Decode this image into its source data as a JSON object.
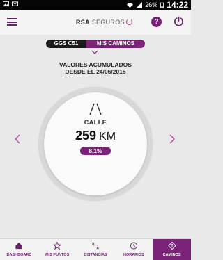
{
  "status_bar": {
    "battery_pct": "26%",
    "time": "14:22"
  },
  "header": {
    "logo_brand": "RSA",
    "logo_text": "SEGUROS",
    "help_label": "?"
  },
  "selector": {
    "left_tab": "GGS C51",
    "right_tab": "MIS CAMINOS"
  },
  "caption": {
    "line1": "VALORES ACUMULADOS",
    "line2": "DESDE EL 24/06/2015"
  },
  "gauge": {
    "category": "CALLE",
    "value": "259",
    "unit": "KM",
    "percent": "8,1%"
  },
  "nav": {
    "items": [
      {
        "label": "DASHBOARD",
        "icon": "home-icon"
      },
      {
        "label": "MIS PUNTOS",
        "icon": "star-icon"
      },
      {
        "label": "DISTANCIAS",
        "icon": "route-icon"
      },
      {
        "label": "HORARIOS",
        "icon": "clock-icon"
      },
      {
        "label": "CAMINOS",
        "icon": "road-sign-icon"
      }
    ],
    "active": "CAMINOS"
  },
  "colors": {
    "brand": "#7b2279",
    "status_bar": "#050505",
    "background": "#e9e9e9"
  }
}
